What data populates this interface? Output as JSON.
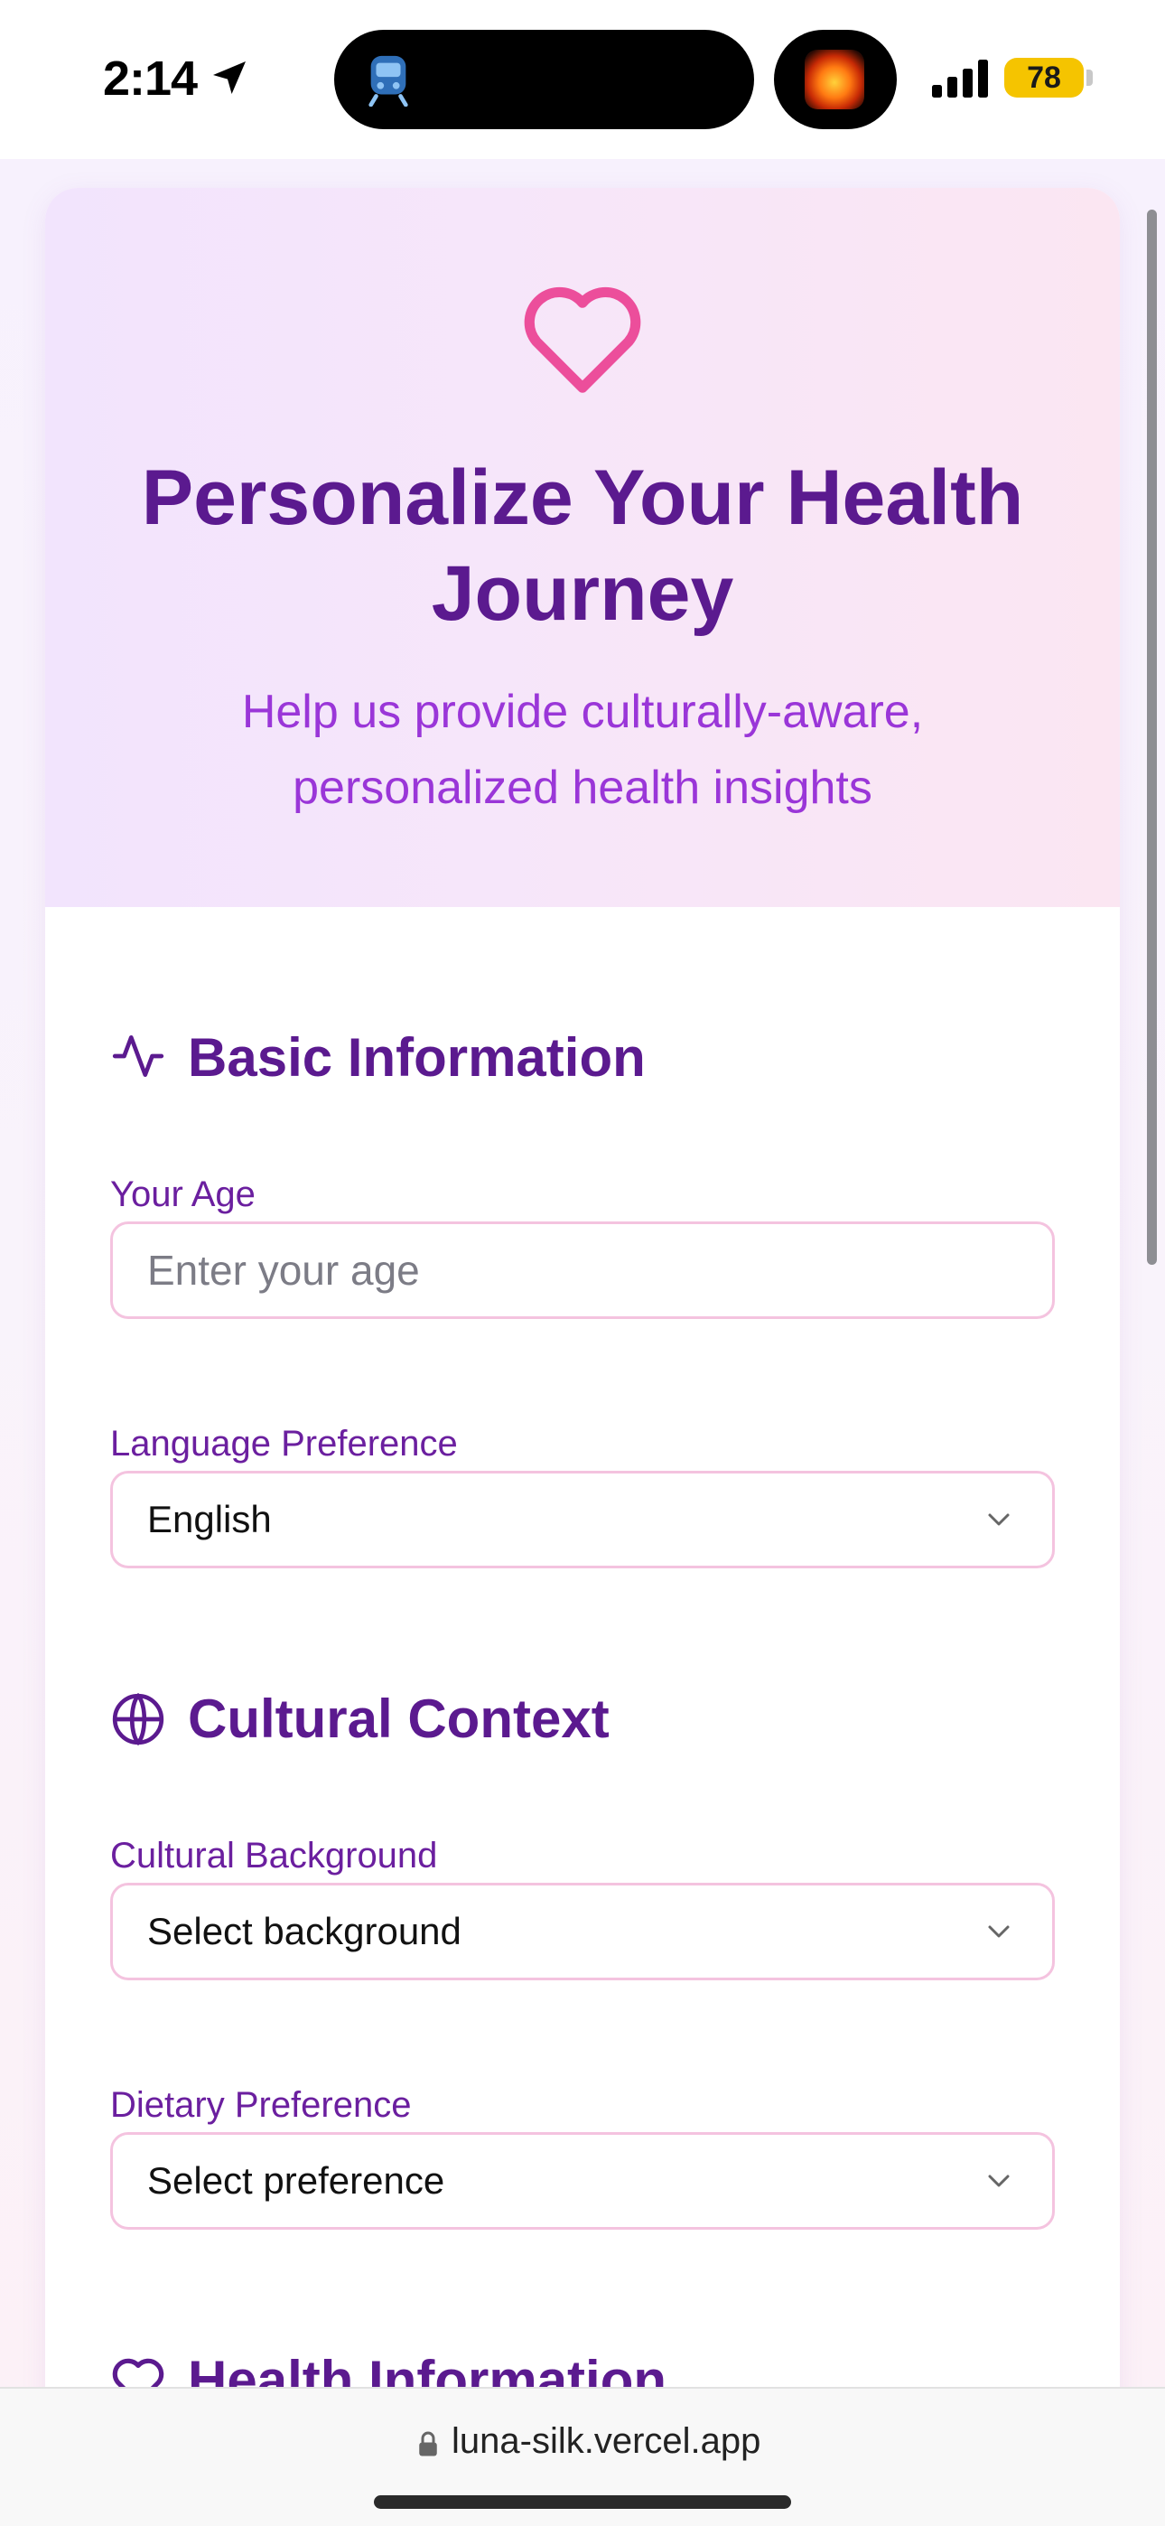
{
  "status_bar": {
    "time": "2:14",
    "battery": "78"
  },
  "header": {
    "icon": "heart-icon",
    "title": "Personalize Your Health Journey",
    "subtitle": "Help us provide culturally-aware, personalized health insights"
  },
  "sections": {
    "basic": {
      "icon": "activity-icon",
      "title": "Basic Information",
      "age_label": "Your Age",
      "age_placeholder": "Enter your age",
      "age_value": "",
      "language_label": "Language Preference",
      "language_value": "English"
    },
    "cultural": {
      "icon": "globe-icon",
      "title": "Cultural Context",
      "background_label": "Cultural Background",
      "background_value": "Select background",
      "dietary_label": "Dietary Preference",
      "dietary_value": "Select preference"
    },
    "health": {
      "icon": "heart-icon",
      "title": "Health Information"
    }
  },
  "browser": {
    "url": "luna-silk.vercel.app"
  },
  "colors": {
    "title": "#5b1a8f",
    "subtitle": "#9a36d8",
    "accent_pink": "#ec4e9b",
    "field_border": "#f4c3df"
  }
}
